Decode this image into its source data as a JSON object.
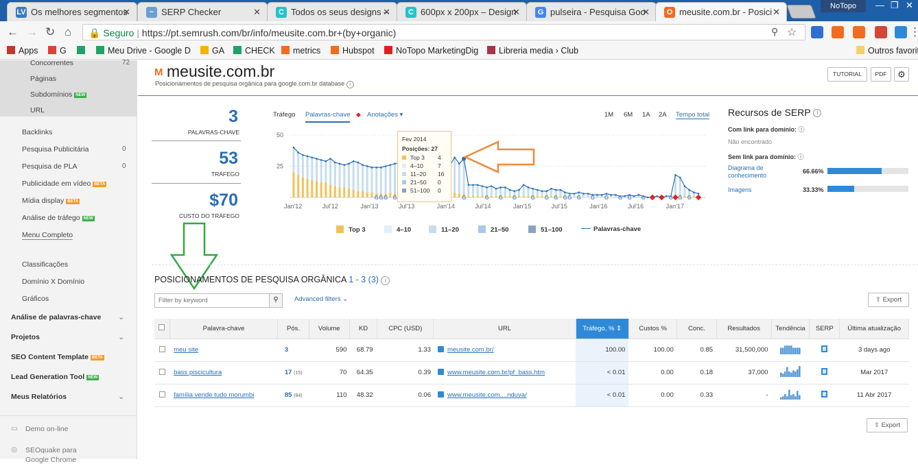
{
  "browser": {
    "tabs": [
      {
        "title": "Os melhores segmentos",
        "icon": "LV",
        "color": "#3b7bbf",
        "left": 10,
        "width": 190
      },
      {
        "title": "SERP Checker",
        "icon": "~",
        "color": "#6a9fd4",
        "left": 200,
        "width": 190
      },
      {
        "title": "Todos os seus designs –",
        "icon": "C",
        "color": "#20c4cb",
        "left": 389,
        "width": 190
      },
      {
        "title": "600px x 200px – Design",
        "icon": "C",
        "color": "#20c4cb",
        "left": 578,
        "width": 190
      },
      {
        "title": "pulseira - Pesquisa Goo",
        "icon": "G",
        "color": "#4285f4",
        "left": 767,
        "width": 190
      },
      {
        "title": "meusite.com.br - Posici",
        "icon": "O",
        "color": "#f26b1f",
        "left": 955,
        "width": 192,
        "active": true
      }
    ],
    "profile": "NoTopo",
    "secure_label": "Seguro",
    "url": "https://pt.semrush.com/br/info/meusite.com.br+(by+organic)",
    "bookmarks": [
      {
        "label": "Apps",
        "color": "#c0392b"
      },
      {
        "label": "G",
        "color": "#d44638"
      },
      {
        "label": "",
        "color": "#1fa463"
      },
      {
        "label": "Meu Drive - Google D",
        "color": "#1fa463"
      },
      {
        "label": "GA",
        "color": "#f4b400"
      },
      {
        "label": "CHECK",
        "color": "#1fa463"
      },
      {
        "label": "metrics",
        "color": "#f26b1f"
      },
      {
        "label": "Hubspot",
        "color": "#f26b1f"
      },
      {
        "label": "NoTopo MarketingDig",
        "color": "#e02020"
      },
      {
        "label": "Libreria media › Club",
        "color": "#aa3344"
      },
      {
        "label": "Outros favorit",
        "color": "#f4d26b"
      }
    ]
  },
  "sidebar": {
    "top_items": [
      "Concorrentes",
      "Páginas",
      "Subdomínios",
      "URL"
    ],
    "top_count": "72",
    "badge_new": "NEW",
    "badge_beta": "BETA",
    "items": [
      {
        "label": "Backlinks",
        "count": ""
      },
      {
        "label": "Pesquisa Publicitária",
        "count": "0"
      },
      {
        "label": "Pesquisa de PLA",
        "count": "0"
      },
      {
        "label": "Publicidade em vídeo",
        "count": ""
      },
      {
        "label": "Mídia display",
        "count": ""
      },
      {
        "label": "Análise de tráfego",
        "count": ""
      },
      {
        "label": "Menu Completo",
        "count": ""
      }
    ],
    "items2": [
      "Classificações",
      "Domínio X Domínio",
      "Gráficos"
    ],
    "sections": [
      {
        "label": "Análise de palavras-chave",
        "chev": true
      },
      {
        "label": "Projetos",
        "chev": true
      },
      {
        "label": "SEO Content Template",
        "chev": false
      },
      {
        "label": "Lead Generation Tool",
        "chev": false
      },
      {
        "label": "Meus Relatórios",
        "chev": true
      }
    ],
    "footer": [
      "Demo on-line",
      "SEOquake para",
      "Google Chrome"
    ]
  },
  "header": {
    "domain": "meusite.com.br",
    "subtitle": "Posicionamentos de pesquisa orgânica para google.com.br database",
    "tutorial": "TUTORIAL",
    "pdf": "PDF"
  },
  "kpis": [
    {
      "value": "3",
      "label": "PALAVRAS-CHAVE"
    },
    {
      "value": "53",
      "label": "TRÁFEGO"
    },
    {
      "value": "$70",
      "label": "CUSTO DO TRÁFEGO"
    }
  ],
  "chart_controls": {
    "trafego": "Tráfego",
    "palavras": "Palavras-chave",
    "anotacoes": "Anotações",
    "ranges": [
      "1M",
      "6M",
      "1A",
      "2A",
      "Tempo total"
    ],
    "active_range": "Tempo total"
  },
  "chart_data": {
    "type": "bar",
    "title": "",
    "y_ticks": [
      "50",
      "25"
    ],
    "ylim": [
      0,
      50
    ],
    "x_ticks": [
      "Jan'12",
      "Jul'12",
      "Jan'13",
      "Jul'13",
      "Jan'14",
      "Jul'14",
      "Jan'15",
      "Jul'15",
      "Jan'16",
      "Jul'16",
      "Jan'17"
    ],
    "legend": [
      "Top 3",
      "4–10",
      "11–20",
      "21–50",
      "51–100",
      "Palavras-chave"
    ],
    "series": [
      {
        "name": "Palavras-chave",
        "values": [
          40,
          36,
          34,
          33,
          32,
          31,
          30,
          29,
          31,
          28,
          27,
          26,
          27,
          29,
          28,
          26,
          25,
          24,
          24,
          24,
          25,
          26,
          27,
          28,
          26,
          27,
          28,
          29,
          27,
          27,
          28,
          27,
          29,
          28,
          26,
          32,
          27,
          31,
          10,
          10,
          10,
          9,
          8,
          9,
          7,
          8,
          8,
          6,
          5,
          6,
          10,
          8,
          7,
          6,
          5,
          5,
          7,
          6,
          6,
          4,
          3,
          3,
          4,
          3,
          3,
          2,
          2,
          2,
          3,
          2,
          2,
          1,
          1,
          2,
          1,
          2,
          1,
          0,
          0,
          1,
          0,
          1,
          1,
          18,
          16,
          9,
          6,
          4,
          3
        ]
      },
      {
        "name": "Top 3",
        "values": [
          20,
          18,
          16,
          15,
          14,
          13,
          12,
          12,
          10,
          9,
          8,
          8,
          7,
          6,
          5,
          5,
          4,
          4,
          3,
          3,
          3,
          4,
          3,
          3,
          3,
          3,
          3,
          3,
          3,
          3,
          3,
          3,
          3,
          3,
          3,
          4,
          3,
          3,
          1,
          1,
          1,
          1,
          1,
          1,
          1,
          1,
          1,
          1,
          1,
          1,
          1,
          1,
          1,
          1,
          1,
          1,
          1,
          1,
          1,
          1,
          0,
          0,
          1,
          0,
          0,
          0,
          0,
          0,
          0,
          0,
          0,
          0,
          0,
          0,
          0,
          0,
          0,
          0,
          0,
          0,
          0,
          0,
          0,
          2,
          2,
          1,
          1,
          1,
          0
        ]
      }
    ],
    "tooltip": {
      "date": "Fev 2014",
      "positions_label": "Posições:",
      "positions": "27",
      "rows": [
        {
          "label": "Top 3",
          "value": "4",
          "color": "#f3c15a"
        },
        {
          "label": "4–10",
          "value": "7",
          "color": "#e2eef8"
        },
        {
          "label": "11–20",
          "value": "16",
          "color": "#c6ddf0"
        },
        {
          "label": "21–50",
          "value": "0",
          "color": "#a8c8e6"
        },
        {
          "label": "51–100",
          "value": "0",
          "color": "#8aa4c2"
        }
      ]
    },
    "colors": {
      "top3": "#f3c15a",
      "b4_10": "#e2eef8",
      "b11_20": "#c6ddf0",
      "b21_50": "#a8c8e6",
      "b51_100": "#8aa4c2",
      "line": "#2a6fb3"
    }
  },
  "serp": {
    "title": "Recursos de SERP",
    "with_link": "Com link para domínio:",
    "not_found": "Não encontrado",
    "without_link": "Sem link para domínio:",
    "rows": [
      {
        "label": "Diagrama de conhecimento",
        "pct": "66.66%",
        "fill": 0.667
      },
      {
        "label": "Imagens",
        "pct": "33.33%",
        "fill": 0.333
      }
    ]
  },
  "table_section": {
    "title": "POSICIONAMENTOS DE PESQUISA ORGÂNICA",
    "range": "1 - 3 (3)",
    "filter_placeholder": "Filter by keyword",
    "advanced": "Advanced filters",
    "export": "Export",
    "columns": [
      "Palavra-chave",
      "Pós.",
      "Volume",
      "KD",
      "CPC (USD)",
      "URL",
      "Tráfego, %",
      "Custos %",
      "Conc.",
      "Resultados",
      "Tendência",
      "SERP",
      "Última atualização"
    ],
    "rows": [
      {
        "kw": "meu site",
        "pos": "3",
        "pos_prev": "",
        "volume": "590",
        "kd": "68.79",
        "cpc": "1.33",
        "url": "meusite.com.br/",
        "traffic": "100.00",
        "costs": "100.00",
        "conc": "0.85",
        "results": "31,500,000",
        "trend": [
          0.6,
          0.6,
          0.8,
          0.8,
          0.8,
          0.8,
          0.6,
          0.6,
          0.6,
          0.6
        ],
        "updated": "3 days ago"
      },
      {
        "kw": "bass piscicultura",
        "pos": "17",
        "pos_prev": "(15)",
        "volume": "70",
        "kd": "64.35",
        "cpc": "0.39",
        "url": "www.meusite.com.br/pf_bass.htm",
        "traffic": "< 0.01",
        "costs": "0.00",
        "conc": "0.18",
        "results": "37,000",
        "trend": [
          0.4,
          0.3,
          0.5,
          0.9,
          0.5,
          0.4,
          0.6,
          0.5,
          0.7,
          1.0
        ],
        "updated": "Mar 2017"
      },
      {
        "kw": "família vende tudo morumbi",
        "pos": "85",
        "pos_prev": "(84)",
        "volume": "110",
        "kd": "48.32",
        "cpc": "0.06",
        "url": "www.meusite.com....nduva/",
        "traffic": "< 0.01",
        "costs": "0.00",
        "conc": "0.33",
        "results": "-",
        "trend": [
          0.2,
          0.3,
          0.5,
          0.3,
          0.9,
          0.4,
          0.5,
          0.3,
          0.8,
          0.4
        ],
        "updated": "11 Abr 2017"
      }
    ]
  }
}
